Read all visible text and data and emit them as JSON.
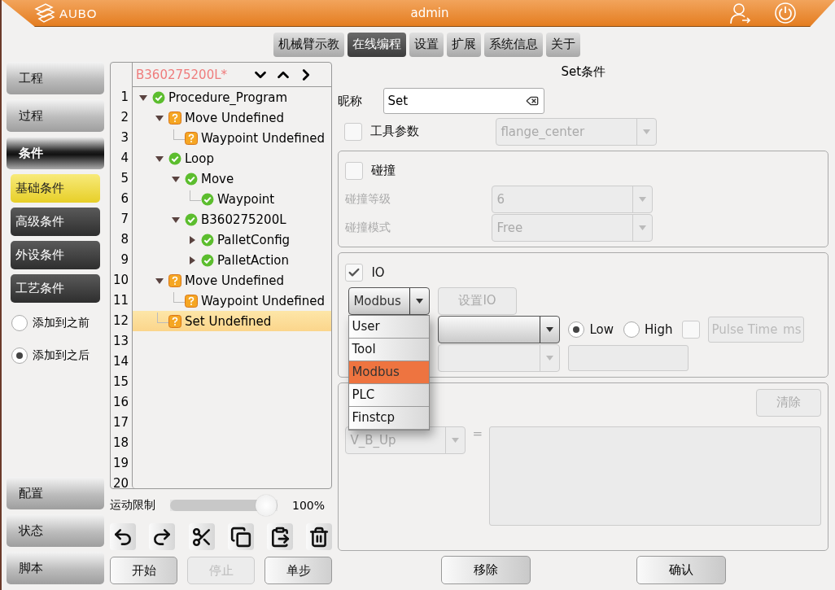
{
  "header": {
    "logo_text": "AUBO",
    "title": "admin"
  },
  "tabs": [
    {
      "label": "机械臂示教",
      "selected": false
    },
    {
      "label": "在线编程",
      "selected": true
    },
    {
      "label": "设置",
      "selected": false
    },
    {
      "label": "扩展",
      "selected": false
    },
    {
      "label": "系统信息",
      "selected": false
    },
    {
      "label": "关于",
      "selected": false
    }
  ],
  "sidebar": {
    "main_items": [
      {
        "label": "工程",
        "selected": false
      },
      {
        "label": "过程",
        "selected": false
      },
      {
        "label": "条件",
        "selected": true
      }
    ],
    "sub_items": [
      {
        "label": "基础条件",
        "selected": true
      },
      {
        "label": "高级条件",
        "selected": false
      },
      {
        "label": "外设条件",
        "selected": false
      },
      {
        "label": "工艺条件",
        "selected": false
      }
    ],
    "insert_options": [
      {
        "label": "添加到之前",
        "selected": false
      },
      {
        "label": "添加到之后",
        "selected": true
      }
    ],
    "bottom_items": [
      "配置",
      "状态",
      "脚本"
    ]
  },
  "program": {
    "name": "B360275200L*",
    "line_numbers": [
      "1",
      "2",
      "3",
      "4",
      "5",
      "6",
      "7",
      "8",
      "9",
      "10",
      "11",
      "12",
      "13",
      "14",
      "15",
      "16",
      "17",
      "18",
      "19",
      "20"
    ],
    "tree": [
      {
        "label": "Procedure_Program",
        "kind": "ok",
        "selected": false,
        "expanded": true,
        "children": [
          {
            "label": "Move Undefined",
            "kind": "warn",
            "selected": false,
            "expanded": true,
            "children": [
              {
                "label": "Waypoint Undefined",
                "kind": "warn",
                "selected": false
              }
            ]
          },
          {
            "label": "Loop",
            "kind": "ok",
            "selected": false,
            "expanded": true,
            "children": [
              {
                "label": "Move",
                "kind": "ok",
                "selected": false,
                "expanded": true,
                "children": [
                  {
                    "label": "Waypoint",
                    "kind": "ok",
                    "selected": false
                  }
                ]
              },
              {
                "label": "B360275200L",
                "kind": "ok",
                "selected": false,
                "expanded": true,
                "children": [
                  {
                    "label": "PalletConfig",
                    "kind": "ok",
                    "selected": false,
                    "expanded": false
                  },
                  {
                    "label": "PalletAction",
                    "kind": "ok",
                    "selected": false,
                    "expanded": false
                  }
                ]
              }
            ]
          },
          {
            "label": "Move Undefined",
            "kind": "warn",
            "selected": false,
            "expanded": true,
            "children": [
              {
                "label": "Waypoint Undefined",
                "kind": "warn",
                "selected": false
              }
            ]
          },
          {
            "label": "Set Undefined",
            "kind": "warn",
            "selected": true
          }
        ]
      }
    ]
  },
  "speed": {
    "label": "运动限制",
    "level": 1,
    "reading": "100%"
  },
  "run_buttons": [
    {
      "label": "开始",
      "disabled": false
    },
    {
      "label": "停止",
      "disabled": true
    },
    {
      "label": "单步",
      "disabled": false
    }
  ],
  "editor": {
    "title": "Set条件",
    "name_field": {
      "label": "昵称",
      "value": "Set"
    },
    "tool": {
      "label": "工具参数",
      "checked": false,
      "value": "flange_center"
    },
    "collision": {
      "label": "碰撞",
      "checked": false,
      "level_label": "碰撞等级",
      "level_value": "6",
      "mode_label": "碰撞模式",
      "mode_value": "Free"
    },
    "io": {
      "label": "IO",
      "checked": true,
      "source": "Modbus",
      "set_button": "设置IO",
      "options": [
        {
          "label": "User",
          "selected": false
        },
        {
          "label": "Tool",
          "selected": false
        },
        {
          "label": "Modbus",
          "selected": true
        },
        {
          "label": "PLC",
          "selected": false
        },
        {
          "label": "Finstcp",
          "selected": false
        }
      ],
      "states": [
        {
          "label": "Low",
          "selected": true
        },
        {
          "label": "High",
          "selected": false
        }
      ],
      "pulse_checked": false,
      "pulse_placeholder": "Pulse Time",
      "pulse_unit": "ms"
    },
    "variable": {
      "clear_button": "清除",
      "value": "V_B_Up",
      "operator": "="
    },
    "buttons": [
      "移除",
      "确认"
    ]
  }
}
